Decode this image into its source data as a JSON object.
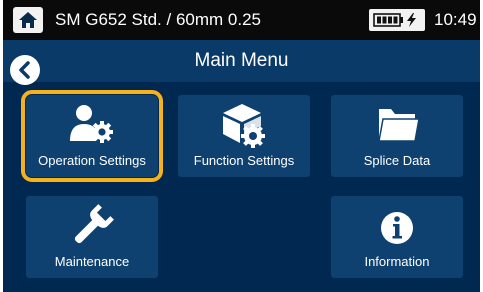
{
  "status_bar": {
    "profile": "SM G652 Std. / 60mm 0.25",
    "time": "10:49"
  },
  "title_bar": {
    "title": "Main Menu"
  },
  "menu": {
    "items": [
      {
        "label": "Operation Settings",
        "icon": "operator-gear-icon",
        "selected": true
      },
      {
        "label": "Function Settings",
        "icon": "cube-gear-icon",
        "selected": false
      },
      {
        "label": "Splice Data",
        "icon": "folder-icon",
        "selected": false
      },
      {
        "label": "Maintenance",
        "icon": "wrench-icon",
        "selected": false
      },
      {
        "label": "Information",
        "icon": "info-icon",
        "selected": false
      }
    ]
  },
  "colors": {
    "background": "#002850",
    "tile": "#0e4170",
    "highlight": "#f5b21d",
    "status_bar": "#0a0a0a"
  }
}
